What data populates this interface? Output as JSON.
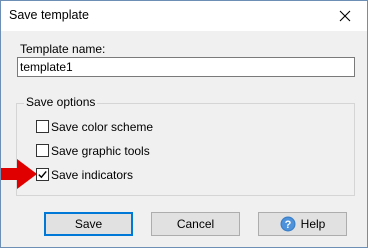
{
  "window": {
    "title": "Save template"
  },
  "form": {
    "template_name_label": "Template name:",
    "template_name_value": "template1"
  },
  "options": {
    "group_label": "Save options",
    "items": [
      {
        "label": "Save color scheme",
        "checked": false
      },
      {
        "label": "Save graphic tools",
        "checked": false
      },
      {
        "label": "Save indicators",
        "checked": true
      }
    ]
  },
  "buttons": {
    "save": "Save",
    "cancel": "Cancel",
    "help": "Help"
  },
  "colors": {
    "accent": "#0078d7",
    "arrow": "#e00000",
    "help_icon": "#3a7fc8"
  },
  "icons": {
    "close": "close-icon",
    "help": "help-icon",
    "arrow": "arrow-right-icon"
  }
}
